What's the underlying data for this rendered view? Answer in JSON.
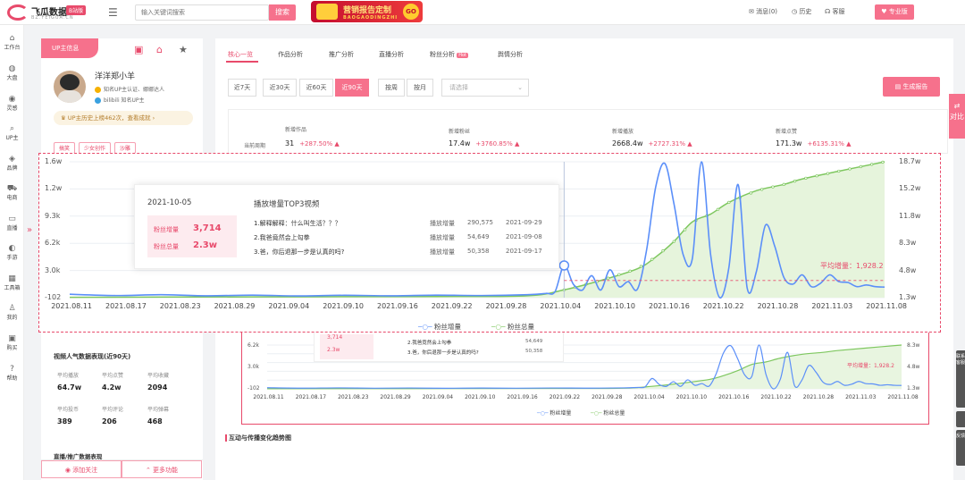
{
  "header": {
    "logo_title": "飞瓜数据",
    "logo_sub": "BZ.FEIGUA.CN",
    "logo_badge": "B站版",
    "search_placeholder": "输入关键词搜索",
    "search_button": "搜索",
    "banner_title": "营销报告定制",
    "banner_sub": "BAOGAODINGZHI",
    "banner_go": "GO",
    "messages": "消息(0)",
    "history": "历史",
    "service": "客服",
    "pro": "专业版"
  },
  "nav": [
    "工作台",
    "大盘",
    "灵感",
    "UP主",
    "品牌",
    "电商",
    "直播",
    "手游",
    "工具箱",
    "我的",
    "购买",
    "帮助"
  ],
  "profile": {
    "tag": "UP主信息",
    "name": "洋洋郑小羊",
    "verify": "知名UP主认证、娜娜达人",
    "bili": "bilibili 知名UP主",
    "rank": "UP主历史上榜462次，查看成就",
    "tags": [
      "搞笑",
      "少女创作",
      "沙雕"
    ]
  },
  "video_stats": {
    "title": "视频人气数据表现(近90天)",
    "items": [
      {
        "label": "平均播放",
        "value": "64.7w"
      },
      {
        "label": "平均点赞",
        "value": "4.2w"
      },
      {
        "label": "平均收藏",
        "value": "2094"
      },
      {
        "label": "平均投币",
        "value": "389"
      },
      {
        "label": "平均评论",
        "value": "206"
      },
      {
        "label": "平均弹幕",
        "value": "468"
      }
    ],
    "live_title": "直播/推广数据表现",
    "follow": "添加关注",
    "more": "更多功能"
  },
  "tabs": [
    {
      "label": "核心一览"
    },
    {
      "label": "作品分析"
    },
    {
      "label": "推广分析"
    },
    {
      "label": "直播分析"
    },
    {
      "label": "粉丝分析",
      "badge": "Hot"
    },
    {
      "label": "舆情分析"
    }
  ],
  "filters": {
    "ranges": [
      "近7天",
      "近30天",
      "近60天",
      "近90天"
    ],
    "units": [
      "按周",
      "按月"
    ],
    "select_placeholder": "请选择",
    "report": "生成报告"
  },
  "kpis": {
    "period_label": "当前周期",
    "items": [
      {
        "label": "新增作品",
        "value": "31",
        "change": "+287.50% ▲"
      },
      {
        "label": "新增粉丝",
        "value": "17.4w",
        "change": "+3760.85% ▲"
      },
      {
        "label": "新增播放",
        "value": "2668.4w",
        "change": "+2727.31% ▲"
      },
      {
        "label": "新增点赞",
        "value": "171.3w",
        "change": "+6135.31% ▲"
      }
    ]
  },
  "chart_data": {
    "type": "line",
    "x_ticks": [
      "2021.08.11",
      "2021.08.17",
      "2021.08.23",
      "2021.08.29",
      "2021.09.04",
      "2021.09.10",
      "2021.09.16",
      "2021.09.22",
      "2021.09.28",
      "2021.10.04",
      "2021.10.10",
      "2021.10.16",
      "2021.10.22",
      "2021.10.28",
      "2021.11.03",
      "2021.11.08"
    ],
    "y_left_ticks": [
      "1.6w",
      "1.2w",
      "9.3k",
      "6.2k",
      "3.0k",
      "-102"
    ],
    "y_right_ticks": [
      "18.7w",
      "15.2w",
      "11.8w",
      "8.3w",
      "4.8w",
      "1.3w"
    ],
    "ylim_left": [
      -102,
      16000
    ],
    "ylim_right": [
      13000,
      187000
    ],
    "x_range": [
      0,
      89
    ],
    "series": [
      {
        "name": "粉丝增量",
        "color": "#5b8ff9",
        "axis": "left",
        "points": [
          [
            0,
            300
          ],
          [
            5,
            150
          ],
          [
            10,
            250
          ],
          [
            15,
            120
          ],
          [
            20,
            200
          ],
          [
            25,
            100
          ],
          [
            30,
            180
          ],
          [
            35,
            120
          ],
          [
            40,
            200
          ],
          [
            45,
            150
          ],
          [
            50,
            250
          ],
          [
            52,
            400
          ],
          [
            53,
            600
          ],
          [
            54,
            3714
          ],
          [
            55,
            1500
          ],
          [
            56,
            800
          ],
          [
            57,
            2500
          ],
          [
            58,
            800
          ],
          [
            59,
            3200
          ],
          [
            60,
            1200
          ],
          [
            61,
            1800
          ],
          [
            62,
            900
          ],
          [
            63,
            5500
          ],
          [
            64,
            13000
          ],
          [
            65,
            15800
          ],
          [
            66,
            11000
          ],
          [
            67,
            5000
          ],
          [
            68,
            4500
          ],
          [
            69,
            16000
          ],
          [
            70,
            5000
          ],
          [
            71,
            -100
          ],
          [
            72,
            3500
          ],
          [
            73,
            13300
          ],
          [
            74,
            1000
          ],
          [
            75,
            3000
          ],
          [
            76,
            8500
          ],
          [
            77,
            6000
          ],
          [
            78,
            2300
          ],
          [
            79,
            1500
          ],
          [
            80,
            2600
          ],
          [
            81,
            1200
          ],
          [
            82,
            1600
          ],
          [
            83,
            2600
          ],
          [
            84,
            1800
          ],
          [
            85,
            1700
          ],
          [
            86,
            1200
          ],
          [
            87,
            1400
          ],
          [
            88,
            1200
          ],
          [
            89,
            1150
          ]
        ]
      },
      {
        "name": "粉丝总量",
        "color": "#7ec75f",
        "axis": "right",
        "points": [
          [
            0,
            13500
          ],
          [
            20,
            14000
          ],
          [
            40,
            14500
          ],
          [
            50,
            15500
          ],
          [
            54,
            23000
          ],
          [
            58,
            35000
          ],
          [
            62,
            50000
          ],
          [
            64,
            65000
          ],
          [
            66,
            85000
          ],
          [
            68,
            110000
          ],
          [
            70,
            120000
          ],
          [
            72,
            135000
          ],
          [
            75,
            150000
          ],
          [
            78,
            158000
          ],
          [
            80,
            165000
          ],
          [
            84,
            175000
          ],
          [
            89,
            187000
          ]
        ]
      }
    ],
    "average_label": "平均增量：1,928.2",
    "average_value": 1928.2,
    "tooltip": {
      "date": "2021-10-05",
      "fans_gain_label": "粉丝增量",
      "fans_gain": "3,714",
      "fans_total_label": "粉丝总量",
      "fans_total": "2.3w",
      "top_title": "播放增量TOP3视频",
      "videos": [
        {
          "title": "1.解释解释：什么叫生活？？？",
          "play_label": "播放增量",
          "plays": "290,575",
          "date": "2021-09-29"
        },
        {
          "title": "2.我爸竟然会上勾拳",
          "play_label": "播放增量",
          "plays": "54,649",
          "date": "2021-09-08"
        },
        {
          "title": "3.爸，你后退那一步是认真的吗?",
          "play_label": "播放增量",
          "plays": "50,358",
          "date": "2021-09-17"
        }
      ]
    }
  },
  "chart2": {
    "y_left_ticks": [
      "6.2k",
      "3.0k",
      "-102"
    ],
    "y_right_ticks": [
      "8.3w",
      "4.8w",
      "1.3w"
    ],
    "tooltip_gain": "3,714",
    "tooltip_total": "2.3w",
    "videos": [
      {
        "title": "2.我爸竟然会上勾拳",
        "plays": "54,649",
        "date": "2021-09-08"
      },
      {
        "title": "3.爸，你后退那一步是认真的吗?",
        "plays": "50,358",
        "date": "2021-09-17"
      }
    ],
    "average_label": "平均增量：1,928.2"
  },
  "section2_title": "互动与传播变化趋势图",
  "right_tab": "对比",
  "right_tools": [
    "联系客服",
    "反馈"
  ]
}
